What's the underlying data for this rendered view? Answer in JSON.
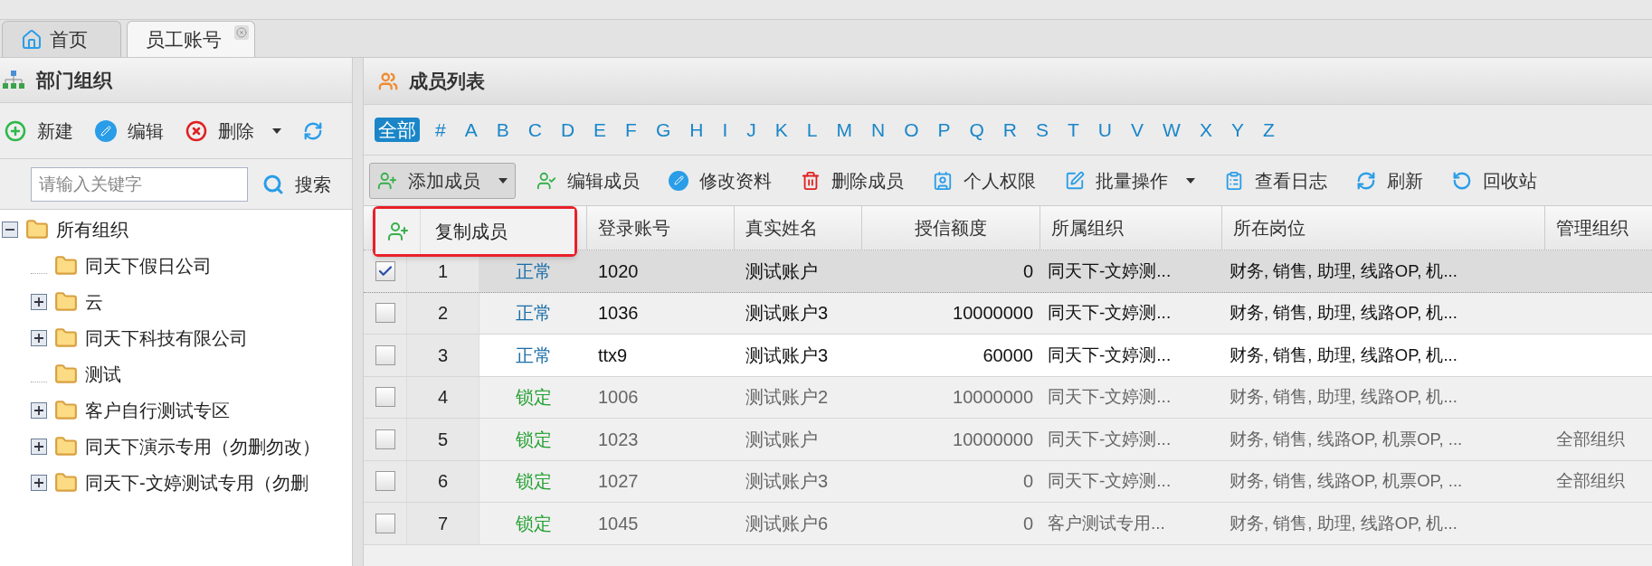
{
  "tabs": [
    {
      "label": "首页",
      "selected": false,
      "closable": false
    },
    {
      "label": "员工账号",
      "selected": true,
      "closable": true
    }
  ],
  "org_panel": {
    "title": "部门组织",
    "toolbar": [
      {
        "kind": "new",
        "label": "新建",
        "dropdown": false
      },
      {
        "kind": "edit",
        "label": "编辑",
        "dropdown": false
      },
      {
        "kind": "delete",
        "label": "删除",
        "dropdown": true
      },
      {
        "kind": "refresh",
        "dropdown": false
      }
    ],
    "search": {
      "placeholder": "请输入关键字",
      "button": "搜索"
    },
    "tree": [
      {
        "label": "所有组织",
        "expandable": true,
        "expanded": true,
        "children": [
          {
            "label": "同天下假日公司",
            "expandable": false,
            "expanded": false
          },
          {
            "label": "云",
            "expandable": true,
            "expanded": false
          },
          {
            "label": "同天下科技有限公司",
            "expandable": true,
            "expanded": false
          },
          {
            "label": "测试",
            "expandable": false,
            "expanded": false
          },
          {
            "label": "客户自行测试专区",
            "expandable": true,
            "expanded": false
          },
          {
            "label": "同天下演示专用（勿删勿改）",
            "expandable": true,
            "expanded": false
          },
          {
            "label": "同天下-文婷测试专用（勿删",
            "expandable": true,
            "expanded": false
          }
        ]
      }
    ]
  },
  "member_panel": {
    "title": "成员列表",
    "letters": [
      {
        "label": "全部",
        "selected": true
      },
      {
        "label": "#",
        "selected": false
      },
      {
        "label": "A",
        "selected": false
      },
      {
        "label": "B",
        "selected": false
      },
      {
        "label": "C",
        "selected": false
      },
      {
        "label": "D",
        "selected": false
      },
      {
        "label": "E",
        "selected": false
      },
      {
        "label": "F",
        "selected": false
      },
      {
        "label": "G",
        "selected": false
      },
      {
        "label": "H",
        "selected": false
      },
      {
        "label": "I",
        "selected": false
      },
      {
        "label": "J",
        "selected": false
      },
      {
        "label": "K",
        "selected": false
      },
      {
        "label": "L",
        "selected": false
      },
      {
        "label": "M",
        "selected": false
      },
      {
        "label": "N",
        "selected": false
      },
      {
        "label": "O",
        "selected": false
      },
      {
        "label": "P",
        "selected": false
      },
      {
        "label": "Q",
        "selected": false
      },
      {
        "label": "R",
        "selected": false
      },
      {
        "label": "S",
        "selected": false
      },
      {
        "label": "T",
        "selected": false
      },
      {
        "label": "U",
        "selected": false
      },
      {
        "label": "V",
        "selected": false
      },
      {
        "label": "W",
        "selected": false
      },
      {
        "label": "X",
        "selected": false
      },
      {
        "label": "Y",
        "selected": false
      },
      {
        "label": "Z",
        "selected": false
      }
    ],
    "toolbar": [
      {
        "kind": "add",
        "label": "添加成员",
        "dropdown": true,
        "open": true
      },
      {
        "kind": "edit_member",
        "label": "编辑成员",
        "dropdown": false,
        "open": false
      },
      {
        "kind": "edit_info",
        "label": "修改资料",
        "dropdown": false,
        "open": false
      },
      {
        "kind": "delete",
        "label": "删除成员",
        "dropdown": false,
        "open": false
      },
      {
        "kind": "permission",
        "label": "个人权限",
        "dropdown": false,
        "open": false
      },
      {
        "kind": "batch",
        "label": "批量操作",
        "dropdown": true,
        "open": false
      },
      {
        "kind": "log",
        "label": "查看日志",
        "dropdown": false,
        "open": false
      },
      {
        "kind": "refresh",
        "label": "刷新",
        "dropdown": false,
        "open": false
      },
      {
        "kind": "recycle",
        "label": "回收站",
        "dropdown": false,
        "open": false
      }
    ],
    "dropdown_menu": {
      "items": [
        {
          "label": "复制成员",
          "highlighted": true
        }
      ]
    },
    "table": {
      "columns": [
        "登录账号",
        "真实姓名",
        "授信额度",
        "所属组织",
        "所在岗位",
        "管理组织"
      ],
      "rows": [
        {
          "checked": true,
          "selected": true,
          "hovered": false,
          "locked": false,
          "no": "1",
          "status": "正常",
          "account": "1020",
          "name": "测试账户",
          "credit": "0",
          "org": "同天下-文婷测...",
          "positions": "财务, 销售, 助理, 线路OP, 机..."
        },
        {
          "checked": false,
          "selected": false,
          "hovered": false,
          "locked": false,
          "no": "2",
          "status": "正常",
          "account": "1036",
          "name": "测试账户3",
          "credit": "10000000",
          "org": "同天下-文婷测...",
          "positions": "财务, 销售, 助理, 线路OP, 机..."
        },
        {
          "checked": false,
          "selected": false,
          "hovered": true,
          "locked": false,
          "no": "3",
          "status": "正常",
          "account": "ttx9",
          "name": "测试账户3",
          "credit": "60000",
          "org": "同天下-文婷测...",
          "positions": "财务, 销售, 助理, 线路OP, 机..."
        },
        {
          "checked": false,
          "selected": false,
          "hovered": false,
          "locked": true,
          "no": "4",
          "status": "锁定",
          "account": "1006",
          "name": "测试账户2",
          "credit": "10000000",
          "org": "同天下-文婷测...",
          "positions": "财务, 销售, 助理, 线路OP, 机..."
        },
        {
          "checked": false,
          "selected": false,
          "hovered": false,
          "locked": true,
          "no": "5",
          "status": "锁定",
          "account": "1023",
          "name": "测试账户",
          "credit": "10000000",
          "org": "同天下-文婷测...",
          "positions": "财务, 销售, 线路OP, 机票OP, ...",
          "manage_org": "全部组织"
        },
        {
          "checked": false,
          "selected": false,
          "hovered": false,
          "locked": true,
          "no": "6",
          "status": "锁定",
          "account": "1027",
          "name": "测试账户3",
          "credit": "0",
          "org": "同天下-文婷测...",
          "positions": "财务, 销售, 线路OP, 机票OP, ...",
          "manage_org": "全部组织"
        },
        {
          "checked": false,
          "selected": false,
          "hovered": false,
          "locked": true,
          "no": "7",
          "status": "锁定",
          "account": "1045",
          "name": "测试账户6",
          "credit": "0",
          "org": "客户测试专用...",
          "positions": "财务, 销售, 助理, 线路OP, 机..."
        }
      ]
    }
  }
}
